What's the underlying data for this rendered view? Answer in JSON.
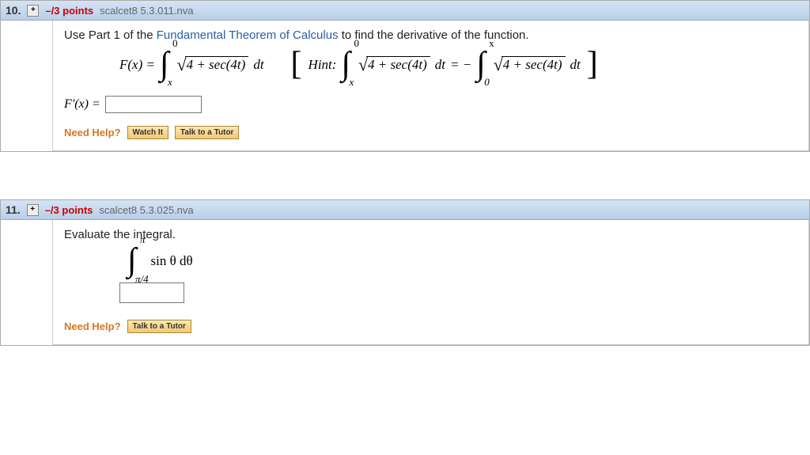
{
  "q10": {
    "number": "10.",
    "expand": "+",
    "points": "–/3 points",
    "assignId": "scalcet8 5.3.011.nva",
    "prompt_before": "Use Part 1 of the ",
    "ftc": "Fundamental Theorem of Calculus",
    "prompt_after": " to find the derivative of the function.",
    "Fx": "F(x) = ",
    "int1_upper": "0",
    "int1_lower": "x",
    "sqrt_arg": "4 + sec(4t)",
    "dt": " dt",
    "hint": "Hint: ",
    "eq_minus": " = − ",
    "int3_upper": "x",
    "int3_lower": "0",
    "Fprime": "F'(x) = ",
    "needHelp": "Need Help?",
    "watchIt": "Watch It",
    "tutor": "Talk to a Tutor"
  },
  "q11": {
    "number": "11.",
    "expand": "+",
    "points": "–/3 points",
    "assignId": "scalcet8 5.3.025.nva",
    "prompt": "Evaluate the integral.",
    "int_upper": "π",
    "int_lower": "π/4",
    "integrand": "sin θ dθ",
    "needHelp": "Need Help?",
    "tutor": "Talk to a Tutor"
  }
}
